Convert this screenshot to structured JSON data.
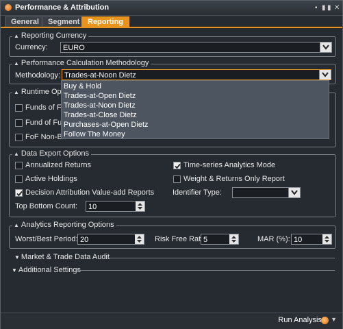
{
  "window": {
    "title": "Performance & Attribution",
    "title_buttons": [
      "▪",
      "▮",
      "▮",
      "✕"
    ]
  },
  "tabs": [
    {
      "label": "General",
      "active": false
    },
    {
      "label": "Segment",
      "active": false
    },
    {
      "label": "Reporting",
      "active": true
    }
  ],
  "reporting_currency": {
    "legend": "Reporting Currency",
    "currency_label": "Currency:",
    "currency_value": "EURO"
  },
  "calc_methodology": {
    "legend": "Performance Calculation Methodology",
    "methodology_label": "Methodology:",
    "methodology_value": "Trades-at-Noon Dietz",
    "options": [
      "Buy & Hold",
      "Trades-at-Open Dietz",
      "Trades-at-Noon Dietz",
      "Trades-at-Close Dietz",
      "Purchases-at-Open Dietz",
      "Follow The Money"
    ]
  },
  "runtime_options": {
    "legend": "Runtime Opti",
    "items": [
      {
        "label": "Funds of Fu",
        "checked": false
      },
      {
        "label": "Fund of Fun",
        "checked": false
      },
      {
        "label": "FoF Non-Bas",
        "checked": false
      }
    ]
  },
  "data_export": {
    "legend": "Data Export Options",
    "annualized_returns": {
      "label": "Annualized Returns",
      "checked": false
    },
    "active_holdings": {
      "label": "Active Holdings",
      "checked": false
    },
    "decision_attribution": {
      "label": "Decision Attribution Value-add Reports",
      "checked": true
    },
    "time_series": {
      "label": "Time-series Analytics Mode",
      "checked": true
    },
    "weight_returns": {
      "label": "Weight & Returns Only Report",
      "checked": false
    },
    "identifier_type_label": "Identifier Type:",
    "identifier_type_value": "",
    "top_bottom_label": "Top Bottom Count:",
    "top_bottom_value": "10"
  },
  "analytics": {
    "legend": "Analytics Reporting Options",
    "worst_best_label": "Worst/Best Period:",
    "worst_best_value": "20",
    "risk_free_label": "Risk Free Rate:",
    "risk_free_value": "5",
    "mar_label": "MAR (%):",
    "mar_value": "10"
  },
  "collapsed_sections": {
    "market_trade": "Market & Trade Data Audit",
    "additional": "Additional Settings"
  },
  "bottom": {
    "run_label": "Run Analysis"
  },
  "colors": {
    "accent": "#e8941c",
    "background": "#262b31",
    "dropdown_bg": "#4d5660"
  },
  "icons": [
    "app-logo-icon",
    "dropdown-arrow-icon",
    "spinner-arrows-icon",
    "checkmark-icon",
    "run-icon",
    "triangle-expand-icon"
  ]
}
